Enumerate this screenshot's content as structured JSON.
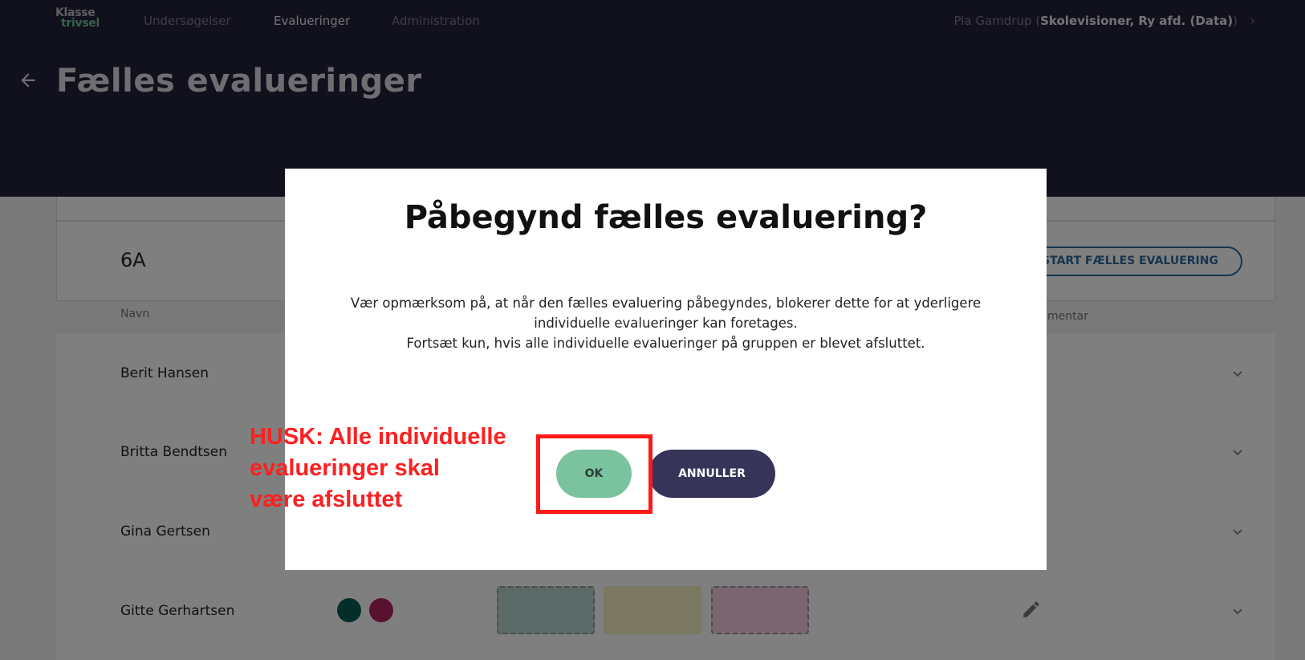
{
  "app": {
    "logo_line1": "Klasse",
    "logo_line2": "trivsel",
    "nav": [
      "Undersøgelser",
      "Evalueringer",
      "Administration"
    ],
    "user_name": "Pia Gamdrup",
    "user_org": "Skolevisioner, Ry afd. (Data)"
  },
  "page": {
    "title": "Fælles evalueringer",
    "class_name": "6A",
    "start_button": "START FÆLLES EVALUERING",
    "col_name": "Navn",
    "col_comment": "mentar",
    "rows": [
      "Berit Hansen",
      "Britta Bendtsen",
      "Gina Gertsen",
      "Gitte Gerhartsen"
    ]
  },
  "colors": {
    "header_bg": "#22203a",
    "accent_green": "#7bc29e",
    "accent_dark": "#37345a",
    "link_blue": "#2d6b9c",
    "annotation_red": "#ff1f1f",
    "dot_teal": "#0b5c52",
    "dot_magenta": "#b0245e",
    "box_teal": "#b8d4cf",
    "box_yellow": "#f5f0c0",
    "box_pink": "#f5cde0"
  },
  "modal": {
    "title": "Påbegynd fælles evaluering?",
    "body_line1": "Vær opmærksom på, at når den fælles evaluering påbegyndes, blokerer dette for at yderligere",
    "body_line2": "individuelle evalueringer kan foretages.",
    "body_line3": "Fortsæt kun, hvis alle individuelle evalueringer på gruppen er blevet afsluttet.",
    "ok_label": "OK",
    "cancel_label": "ANNULLER"
  },
  "annotation": {
    "line1": "HUSK: Alle individuelle",
    "line2": "evalueringer skal",
    "line3": "være afsluttet"
  }
}
